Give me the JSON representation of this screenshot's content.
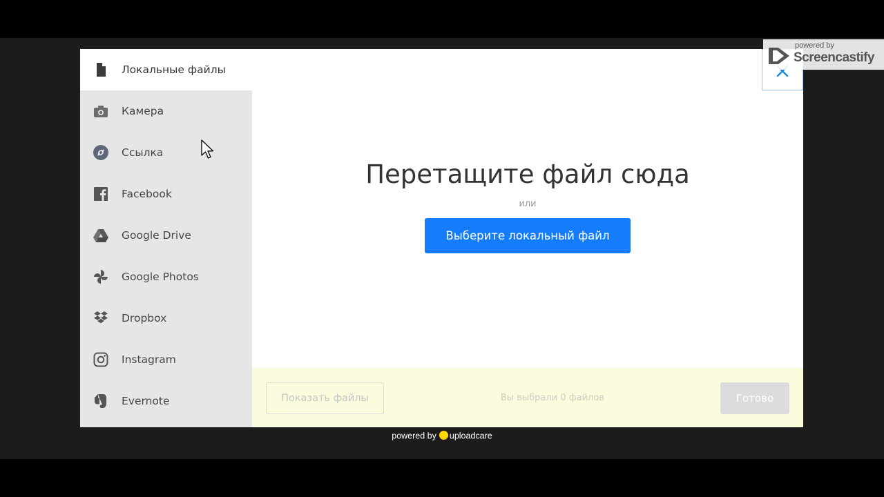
{
  "sidebar": {
    "items": [
      {
        "label": "Локальные файлы",
        "icon": "file-icon"
      },
      {
        "label": "Камера",
        "icon": "camera-icon"
      },
      {
        "label": "Ссылка",
        "icon": "link-icon"
      },
      {
        "label": "Facebook",
        "icon": "facebook-icon"
      },
      {
        "label": "Google Drive",
        "icon": "google-drive-icon"
      },
      {
        "label": "Google Photos",
        "icon": "google-photos-icon"
      },
      {
        "label": "Dropbox",
        "icon": "dropbox-icon"
      },
      {
        "label": "Instagram",
        "icon": "instagram-icon"
      },
      {
        "label": "Evernote",
        "icon": "evernote-icon"
      }
    ],
    "active": "Локальные файлы"
  },
  "main": {
    "drop_title": "Перетащите файл сюда",
    "or": "или",
    "choose_button": "Выберите локальный файл"
  },
  "footer": {
    "show_files_button": "Показать файлы",
    "status": "Вы выбрали 0 файлов",
    "done_button": "Готово"
  },
  "watermark": {
    "small": "powered by",
    "big": "Screencastify"
  },
  "powered_by": {
    "prefix": "powered by",
    "brand": "uploadcare"
  },
  "colors": {
    "accent": "#157cfc",
    "footer_bg": "#fbfbde",
    "sidebar_bg": "#e6e6e6",
    "close_icon": "#1a87d8"
  }
}
